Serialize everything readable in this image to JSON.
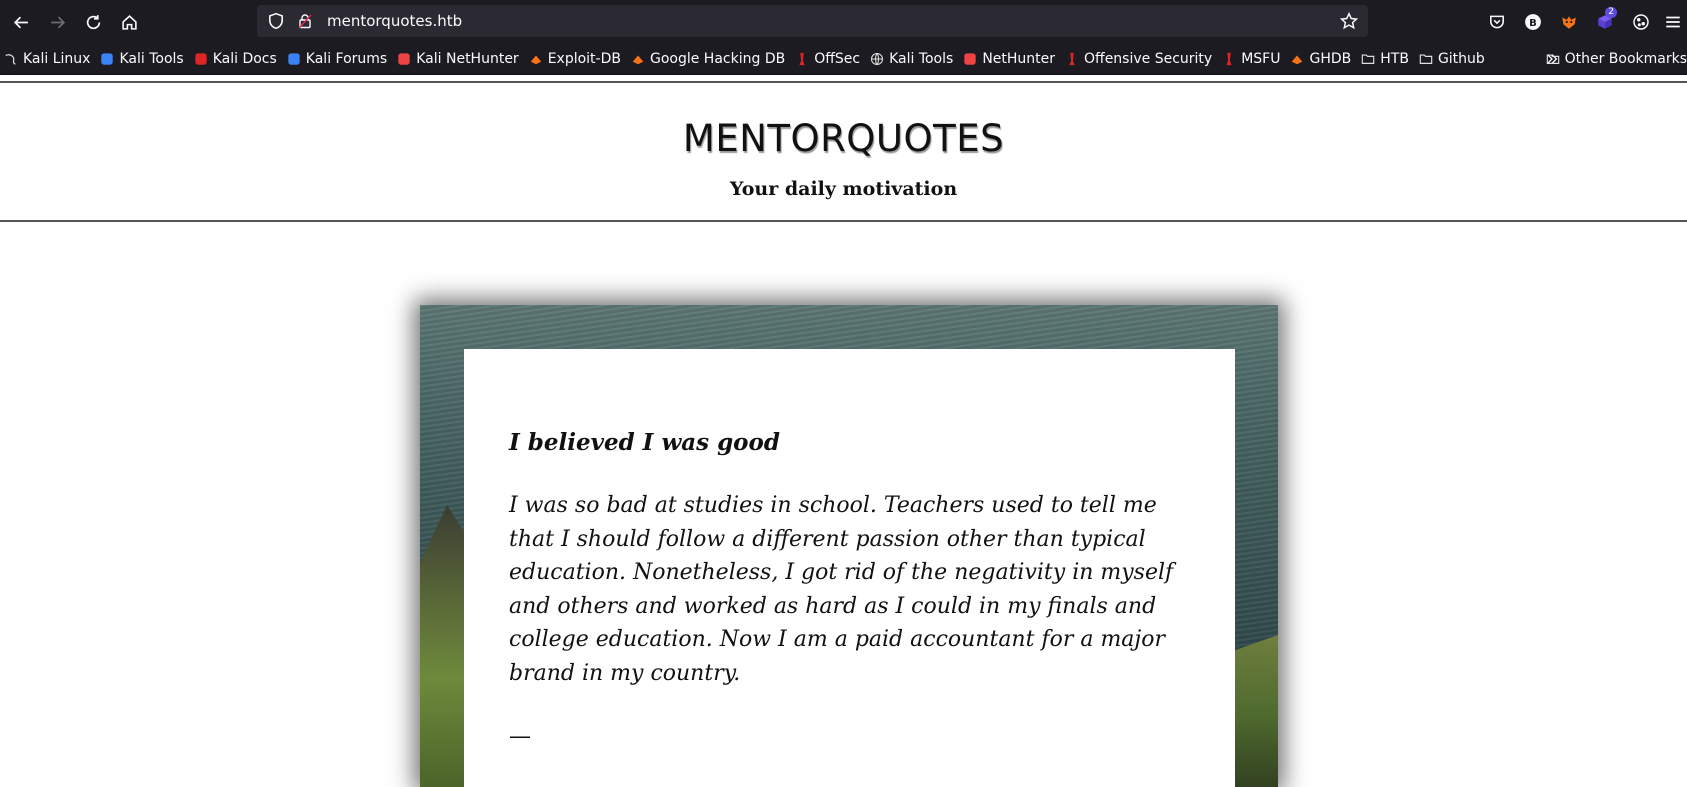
{
  "browser": {
    "url": "mentorquotes.htb",
    "extension_badge": "2"
  },
  "bookmarks": [
    {
      "label": "Kali Linux",
      "icon": "kali-dragon-icon",
      "color": "#e0e0e0"
    },
    {
      "label": "Kali Tools",
      "icon": "kali-tools-icon",
      "color": "#3b82f6"
    },
    {
      "label": "Kali Docs",
      "icon": "kali-docs-icon",
      "color": "#dc2626"
    },
    {
      "label": "Kali Forums",
      "icon": "kali-forums-icon",
      "color": "#3b82f6"
    },
    {
      "label": "Kali NetHunter",
      "icon": "nethunter-icon",
      "color": "#ef4444"
    },
    {
      "label": "Exploit-DB",
      "icon": "exploit-db-icon",
      "color": "#f97316"
    },
    {
      "label": "Google Hacking DB",
      "icon": "ghdb-icon",
      "color": "#f97316"
    },
    {
      "label": "OffSec",
      "icon": "offsec-icon",
      "color": "#dc2626"
    },
    {
      "label": "Kali Tools",
      "icon": "globe-icon",
      "color": "#e0e0e0"
    },
    {
      "label": "NetHunter",
      "icon": "nethunter-icon",
      "color": "#ef4444"
    },
    {
      "label": "Offensive Security",
      "icon": "offsec-icon",
      "color": "#dc2626"
    },
    {
      "label": "MSFU",
      "icon": "offsec-icon",
      "color": "#dc2626"
    },
    {
      "label": "GHDB",
      "icon": "ghdb-icon",
      "color": "#f97316"
    },
    {
      "label": "HTB",
      "icon": "folder-icon",
      "color": "#e0e0e0"
    },
    {
      "label": "Github",
      "icon": "folder-icon",
      "color": "#e0e0e0"
    }
  ],
  "other_bookmarks": "Other Bookmarks",
  "site": {
    "title": "MENTORQUOTES",
    "subtitle": "Your daily motivation"
  },
  "quote": {
    "title": "I believed I was good",
    "body": "I was so bad at studies in school. Teachers used to tell me that I should follow a different passion other than typical education. Nonetheless, I got rid of the negativity in myself and others and worked as hard as I could in my finals and college education. Now I am a paid accountant for a major brand in my country.",
    "dash": "—"
  }
}
